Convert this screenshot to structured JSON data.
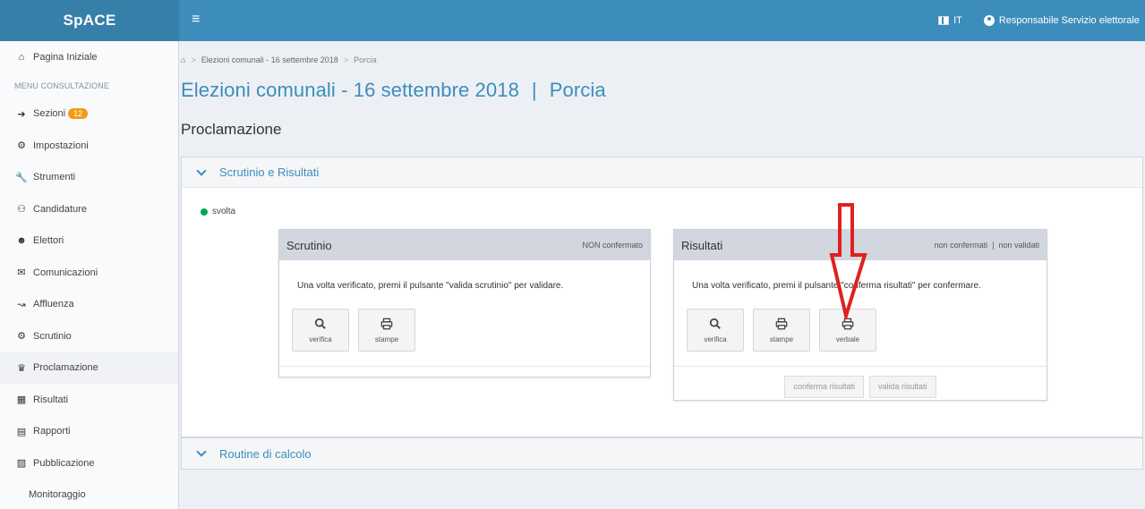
{
  "app": {
    "brand": "SpACE"
  },
  "header": {
    "menu_icon": "hamburger-icon",
    "language": "IT",
    "user": "Responsabile Servizio elettorale"
  },
  "sidebar": {
    "home": "Pagina Iniziale",
    "section_header": "MENU CONSULTAZIONE",
    "items": [
      {
        "label": "Sezioni",
        "icon": "sign-in-icon",
        "badge": "12"
      },
      {
        "label": "Impostazioni",
        "icon": "gear-icon"
      },
      {
        "label": "Strumenti",
        "icon": "wrench-icon"
      },
      {
        "label": "Candidature",
        "icon": "users-icon"
      },
      {
        "label": "Elettori",
        "icon": "group-icon"
      },
      {
        "label": "Comunicazioni",
        "icon": "envelope-icon"
      },
      {
        "label": "Affluenza",
        "icon": "line-chart-icon"
      },
      {
        "label": "Scrutinio",
        "icon": "cogs-icon"
      },
      {
        "label": "Proclamazione",
        "icon": "trophy-icon",
        "active": true
      },
      {
        "label": "Risultati",
        "icon": "bar-chart-icon"
      },
      {
        "label": "Rapporti",
        "icon": "file-icon"
      },
      {
        "label": "Pubblicazione",
        "icon": "copy-icon"
      }
    ],
    "monitoring": "Monitoraggio"
  },
  "breadcrumb": {
    "level1": "Elezioni comunali - 16 settembre 2018",
    "level2": "Porcia"
  },
  "page": {
    "title_main": "Elezioni comunali - 16 settembre 2018",
    "title_separator": "|",
    "title_place": "Porcia",
    "subtitle": "Proclamazione"
  },
  "section1": {
    "title": "Scrutinio e Risultati",
    "status": "svolta",
    "status_color": "#00a65a",
    "scrutinio": {
      "title": "Scrutinio",
      "status": "NON confermato",
      "message": "Una volta verificato, premi il pulsante \"valida scrutinio\" per validare.",
      "buttons": {
        "verifica": "verifica",
        "stampe": "stampe"
      }
    },
    "risultati": {
      "title": "Risultati",
      "status_a": "non confermati",
      "status_sep": "|",
      "status_b": "non validati",
      "message": "Una volta verificato, premi il pulsante \"conferma risultati\" per confermare.",
      "buttons": {
        "verifica": "verifica",
        "stampe": "stampe",
        "verbale": "verbale"
      },
      "footer": {
        "conferma": "conferma risultati",
        "valida": "valida risultati"
      }
    }
  },
  "section2": {
    "title": "Routine di calcolo"
  },
  "colors": {
    "primary": "#3c8dbc",
    "brand_bg": "#367fa9",
    "badge": "#f39c12",
    "annotation": "#e02020"
  }
}
